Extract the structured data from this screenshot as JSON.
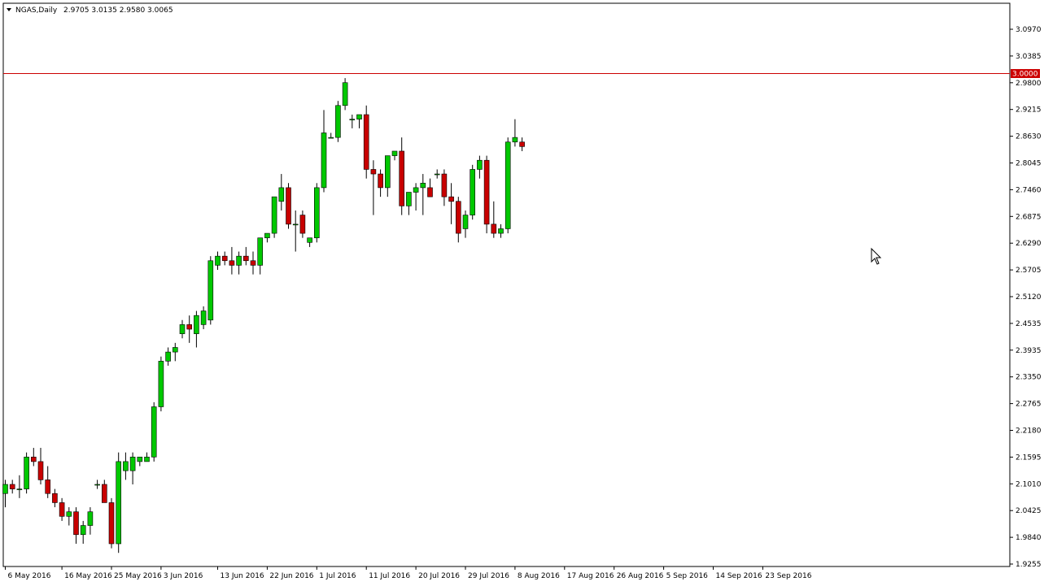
{
  "title": {
    "symbol": "NGAS,Daily",
    "ohlc": "2.9705 3.0135 2.9580 3.0065"
  },
  "colors": {
    "background": "#ffffff",
    "frame": "#000000",
    "bull": "#00c800",
    "bear": "#c80000",
    "wick": "#000000",
    "price_line": "#cc0000",
    "price_label_bg": "#cc0000",
    "price_label_text": "#ffffff"
  },
  "chart_data": {
    "type": "candlestick",
    "ylim": [
      1.9255,
      3.1263
    ],
    "y_ticks": [
      "3.0970",
      "3.0385",
      "2.9800",
      "2.9215",
      "2.8630",
      "2.8045",
      "2.7460",
      "2.6875",
      "2.6290",
      "2.5705",
      "2.5120",
      "2.4535",
      "2.3935",
      "2.3350",
      "2.2765",
      "2.2180",
      "2.1595",
      "2.1010",
      "2.0425",
      "1.9840",
      "1.9255"
    ],
    "x_ticks": [
      {
        "label": "6 May 2016",
        "index": 0
      },
      {
        "label": "16 May 2016",
        "index": 8
      },
      {
        "label": "25 May 2016",
        "index": 15
      },
      {
        "label": "3 Jun 2016",
        "index": 22
      },
      {
        "label": "13 Jun 2016",
        "index": 30
      },
      {
        "label": "22 Jun 2016",
        "index": 37
      },
      {
        "label": "1 Jul 2016",
        "index": 44
      },
      {
        "label": "11 Jul 2016",
        "index": 51
      },
      {
        "label": "20 Jul 2016",
        "index": 58
      },
      {
        "label": "29 Jul 2016",
        "index": 65
      },
      {
        "label": "8 Aug 2016",
        "index": 72
      },
      {
        "label": "17 Aug 2016",
        "index": 79
      },
      {
        "label": "26 Aug 2016",
        "index": 86
      },
      {
        "label": "5 Sep 2016",
        "index": 93
      },
      {
        "label": "14 Sep 2016",
        "index": 100
      },
      {
        "label": "23 Sep 2016",
        "index": 107
      }
    ],
    "current_price": "3.0000",
    "candles": [
      [
        2.08,
        2.11,
        2.05,
        2.1
      ],
      [
        2.1,
        2.11,
        2.08,
        2.09
      ],
      [
        2.09,
        2.12,
        2.07,
        2.09
      ],
      [
        2.09,
        2.17,
        2.08,
        2.16
      ],
      [
        2.16,
        2.18,
        2.14,
        2.15
      ],
      [
        2.15,
        2.18,
        2.1,
        2.11
      ],
      [
        2.11,
        2.14,
        2.07,
        2.08
      ],
      [
        2.08,
        2.09,
        2.05,
        2.06
      ],
      [
        2.06,
        2.07,
        2.02,
        2.03
      ],
      [
        2.03,
        2.05,
        2.01,
        2.04
      ],
      [
        2.04,
        2.05,
        1.97,
        1.99
      ],
      [
        1.99,
        2.02,
        1.97,
        2.01
      ],
      [
        2.01,
        2.05,
        1.99,
        2.04
      ],
      [
        2.1,
        2.11,
        2.09,
        2.1
      ],
      [
        2.1,
        2.11,
        2.06,
        2.06
      ],
      [
        2.06,
        2.07,
        1.96,
        1.97
      ],
      [
        1.97,
        2.17,
        1.95,
        2.15
      ],
      [
        2.13,
        2.17,
        2.11,
        2.15
      ],
      [
        2.13,
        2.17,
        2.1,
        2.16
      ],
      [
        2.15,
        2.16,
        2.14,
        2.16
      ],
      [
        2.15,
        2.17,
        2.15,
        2.16
      ],
      [
        2.16,
        2.28,
        2.15,
        2.27
      ],
      [
        2.27,
        2.38,
        2.26,
        2.37
      ],
      [
        2.37,
        2.4,
        2.36,
        2.39
      ],
      [
        2.39,
        2.41,
        2.37,
        2.4
      ],
      [
        2.43,
        2.46,
        2.42,
        2.45
      ],
      [
        2.45,
        2.47,
        2.41,
        2.44
      ],
      [
        2.43,
        2.48,
        2.4,
        2.47
      ],
      [
        2.45,
        2.49,
        2.44,
        2.48
      ],
      [
        2.46,
        2.6,
        2.45,
        2.59
      ],
      [
        2.58,
        2.61,
        2.57,
        2.6
      ],
      [
        2.6,
        2.61,
        2.58,
        2.59
      ],
      [
        2.59,
        2.62,
        2.56,
        2.58
      ],
      [
        2.58,
        2.61,
        2.56,
        2.6
      ],
      [
        2.6,
        2.62,
        2.58,
        2.59
      ],
      [
        2.59,
        2.61,
        2.56,
        2.58
      ],
      [
        2.58,
        2.64,
        2.56,
        2.64
      ],
      [
        2.64,
        2.65,
        2.63,
        2.65
      ],
      [
        2.65,
        2.73,
        2.64,
        2.73
      ],
      [
        2.72,
        2.78,
        2.7,
        2.75
      ],
      [
        2.75,
        2.76,
        2.66,
        2.67
      ],
      [
        2.67,
        2.7,
        2.61,
        2.67
      ],
      [
        2.69,
        2.7,
        2.64,
        2.65
      ],
      [
        2.63,
        2.64,
        2.62,
        2.64
      ],
      [
        2.64,
        2.76,
        2.63,
        2.75
      ],
      [
        2.75,
        2.92,
        2.74,
        2.87
      ],
      [
        2.86,
        2.87,
        2.86,
        2.86
      ],
      [
        2.86,
        2.94,
        2.85,
        2.93
      ],
      [
        2.93,
        2.99,
        2.92,
        2.98
      ],
      [
        2.9,
        2.91,
        2.88,
        2.9
      ],
      [
        2.9,
        2.91,
        2.88,
        2.91
      ],
      [
        2.91,
        2.93,
        2.77,
        2.79
      ],
      [
        2.79,
        2.81,
        2.69,
        2.78
      ],
      [
        2.78,
        2.79,
        2.73,
        2.75
      ],
      [
        2.75,
        2.82,
        2.73,
        2.82
      ],
      [
        2.82,
        2.83,
        2.81,
        2.83
      ],
      [
        2.83,
        2.86,
        2.69,
        2.71
      ],
      [
        2.71,
        2.73,
        2.69,
        2.74
      ],
      [
        2.74,
        2.76,
        2.7,
        2.75
      ],
      [
        2.75,
        2.78,
        2.69,
        2.76
      ],
      [
        2.75,
        2.77,
        2.73,
        2.73
      ],
      [
        2.78,
        2.79,
        2.77,
        2.78
      ],
      [
        2.78,
        2.79,
        2.71,
        2.73
      ],
      [
        2.73,
        2.76,
        2.67,
        2.72
      ],
      [
        2.72,
        2.73,
        2.63,
        2.65
      ],
      [
        2.66,
        2.7,
        2.64,
        2.69
      ],
      [
        2.69,
        2.8,
        2.68,
        2.79
      ],
      [
        2.79,
        2.82,
        2.77,
        2.81
      ],
      [
        2.81,
        2.82,
        2.65,
        2.67
      ],
      [
        2.67,
        2.72,
        2.64,
        2.65
      ],
      [
        2.65,
        2.67,
        2.64,
        2.66
      ],
      [
        2.66,
        2.86,
        2.65,
        2.85
      ],
      [
        2.85,
        2.9,
        2.84,
        2.86
      ],
      [
        2.85,
        2.86,
        2.83,
        2.84
      ]
    ]
  }
}
